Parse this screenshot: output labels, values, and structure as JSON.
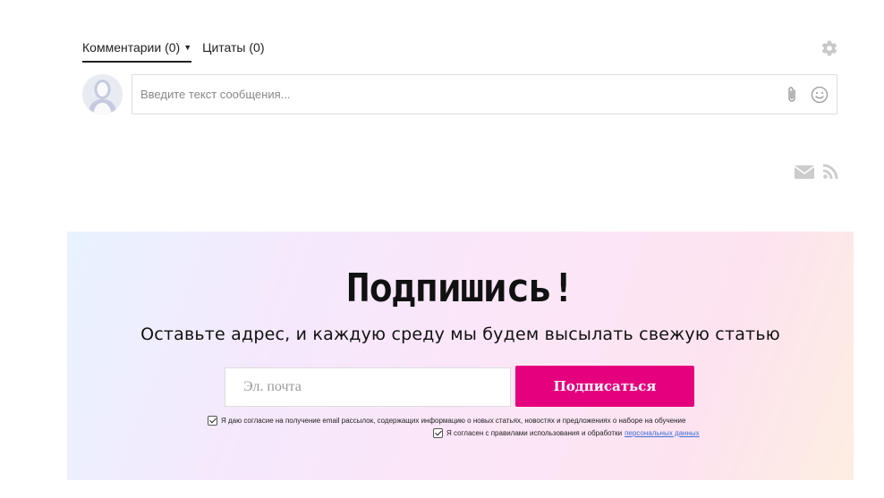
{
  "tabs": [
    {
      "label": "Комментарии (0)",
      "active": true
    },
    {
      "label": "Цитаты (0)",
      "active": false
    }
  ],
  "icons": {
    "settings": "gear-icon",
    "attach": "paperclip-icon",
    "emoji": "smile-icon",
    "mail": "mail-icon",
    "rss": "rss-icon",
    "dropdown": "caret-down-icon"
  },
  "comment": {
    "placeholder": "Введите текст сообщения...",
    "value": ""
  },
  "subscribe": {
    "title": "Подпишись!",
    "subtitle": "Оставьте адрес, и каждую среду мы будем высылать свежую статью",
    "email_placeholder": "Эл. почта",
    "button_label": "Подписаться",
    "consent_1": "Я даю согласие на получение email рассылок, содержащих информацию о новых статьях, новостях и предложениях о наборе на обучение",
    "consent_2_text": "Я согласен с правилами использования и обработки",
    "consent_2_link": "персональных данных",
    "consent_1_checked": true,
    "consent_2_checked": true
  },
  "colors": {
    "accent": "#e5007e",
    "icon_gray": "#c8c8c8",
    "link": "#3d6fd9"
  }
}
